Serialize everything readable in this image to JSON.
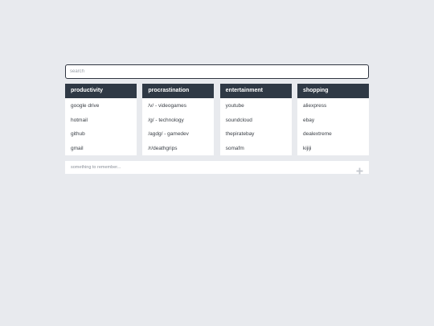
{
  "search": {
    "placeholder": "search",
    "value": ""
  },
  "columns": [
    {
      "title": "productivity",
      "links": [
        "google drive",
        "hotmail",
        "github",
        "gmail"
      ]
    },
    {
      "title": "procrastination",
      "links": [
        "/v/ - videogames",
        "/g/ - technology",
        "/agdg/ - gamedev",
        "/r/deathgrips"
      ]
    },
    {
      "title": "entertainment",
      "links": [
        "youtube",
        "soundcloud",
        "thepiratebay",
        "somafm"
      ]
    },
    {
      "title": "shopping",
      "links": [
        "aliexpress",
        "ebay",
        "dealextreme",
        "kijiji"
      ]
    }
  ],
  "note": {
    "placeholder": "something to remember...",
    "value": ""
  },
  "icons": {
    "add": "plus-icon"
  },
  "colors": {
    "background": "#e8eaee",
    "header": "#2f3945",
    "card": "#ffffff",
    "text": "#3a3f46"
  }
}
